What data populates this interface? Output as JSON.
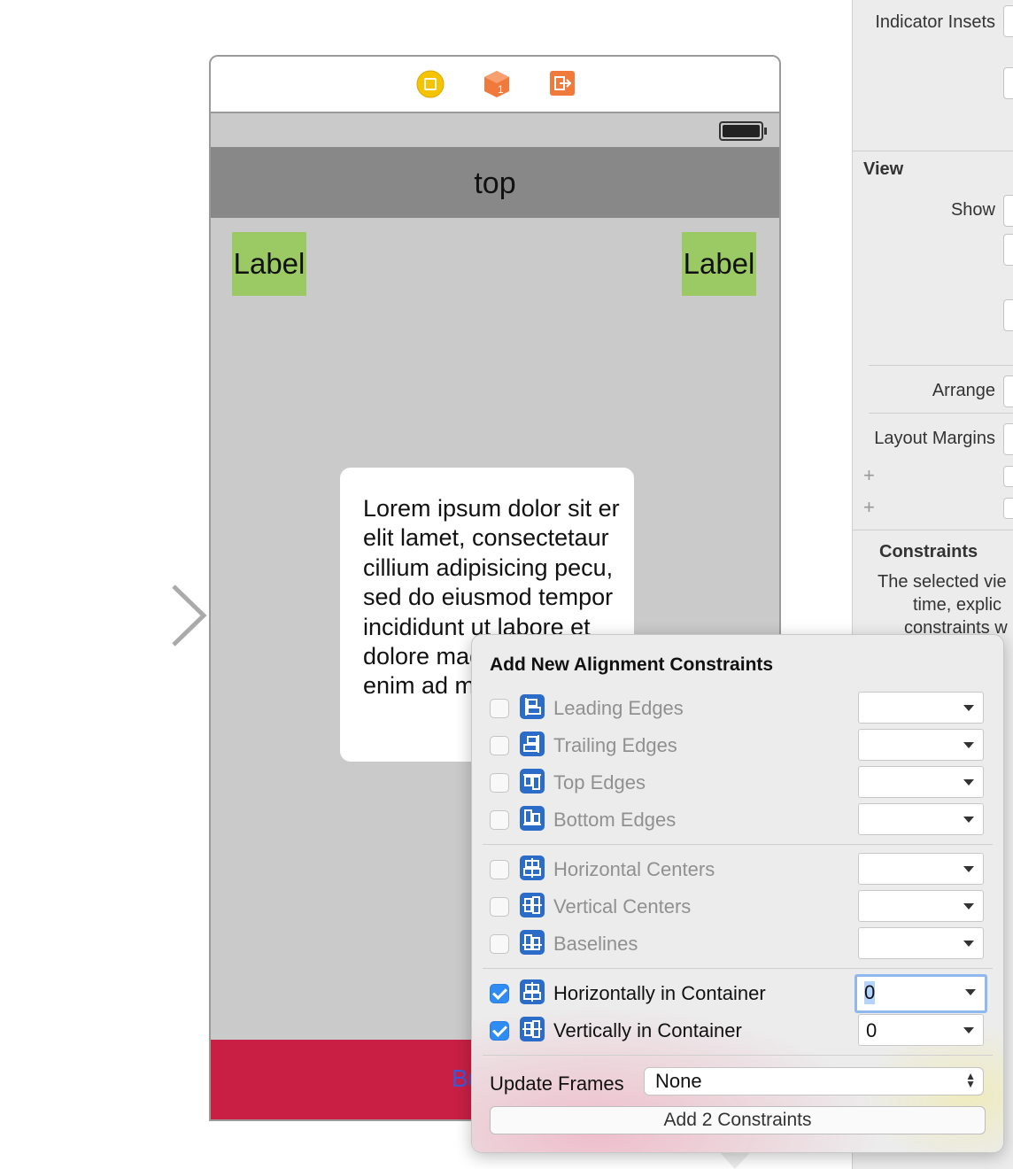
{
  "inspector": {
    "indicator_insets_label": "Indicator Insets",
    "view_header": "View",
    "show_label": "Show",
    "arrange_label": "Arrange",
    "layout_margins_label": "Layout Margins",
    "plus_1": "+",
    "plus_2": "+",
    "constraints_header": "Constraints",
    "constraints_text_1": "The selected vie",
    "constraints_text_2": "time, explic",
    "constraints_text_3": "constraints w"
  },
  "scene": {
    "nav_title": "top",
    "label_left": "Label",
    "label_right": "Label",
    "lorem_text": "Lorem ipsum dolor sit er elit lamet, consectetaur cillium adipisicing pecu, sed do eiusmod tempor incididunt ut labore et dolore magna aliqua. Ut enim ad minim veniam",
    "bottom_button": "Button",
    "colors": {
      "navbar": "#888888",
      "label_bg": "#9bc963",
      "bottom_bar": "#c91f45",
      "dock_icon_yellow": "#f5c400",
      "dock_icon_orange": "#f07a3c"
    },
    "dock_icons": [
      "view-controller-icon",
      "first-responder-icon",
      "exit-icon"
    ]
  },
  "popover": {
    "title": "Add New Alignment Constraints",
    "rows": [
      {
        "label": "Leading Edges",
        "checked": false,
        "value": ""
      },
      {
        "label": "Trailing Edges",
        "checked": false,
        "value": ""
      },
      {
        "label": "Top Edges",
        "checked": false,
        "value": ""
      },
      {
        "label": "Bottom Edges",
        "checked": false,
        "value": ""
      },
      {
        "label": "Horizontal Centers",
        "checked": false,
        "value": ""
      },
      {
        "label": "Vertical Centers",
        "checked": false,
        "value": ""
      },
      {
        "label": "Baselines",
        "checked": false,
        "value": ""
      },
      {
        "label": "Horizontally in Container",
        "checked": true,
        "value": "0"
      },
      {
        "label": "Vertically in Container",
        "checked": true,
        "value": "0"
      }
    ],
    "update_frames_label": "Update Frames",
    "update_frames_value": "None",
    "add_button": "Add 2 Constraints",
    "accent": "#2f8cf4",
    "icon_color": "#2a6cc7"
  }
}
